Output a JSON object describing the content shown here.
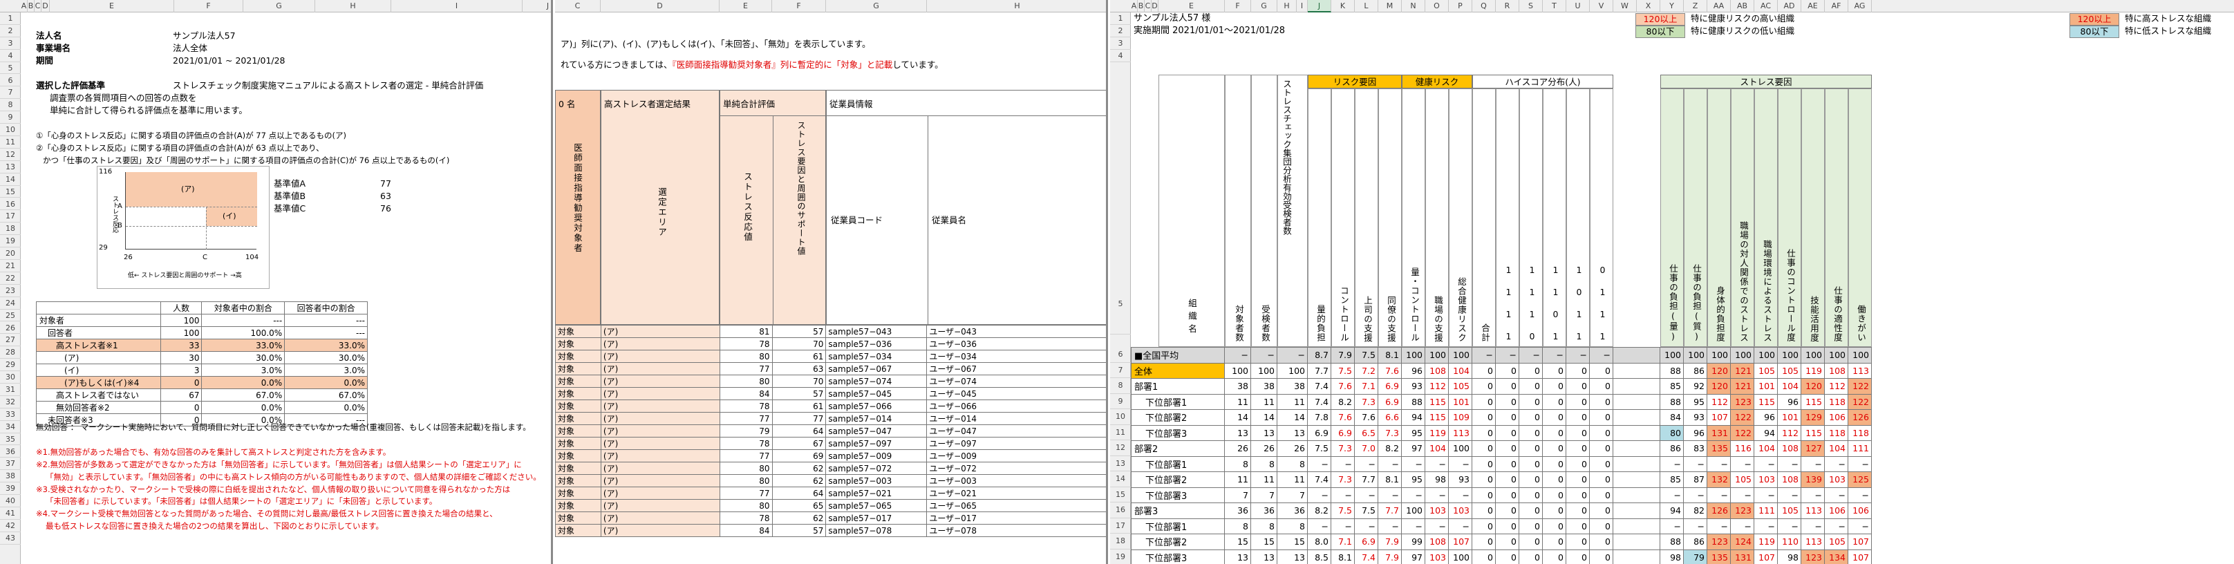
{
  "pane1": {
    "cols": [
      "A",
      "B",
      "C",
      "D",
      "E",
      "F",
      "G",
      "H",
      "I",
      "J"
    ],
    "info": [
      {
        "label": "法人名",
        "value": "サンプル法人57"
      },
      {
        "label": "事業場名",
        "value": "法人全体"
      },
      {
        "label": "期間",
        "value": "2021/01/01 ~ 2021/01/28"
      }
    ],
    "method_label": "選択した評価基準",
    "method_value": "ストレスチェック制度実施マニュアルによる高ストレス者の選定 - 単純合計評価",
    "method_lines": [
      "調査票の各質問項目への回答の点数を",
      "単純に合計して得られる評価点を基準に用います。"
    ],
    "criteria_lines": [
      "①「心身のストレス反応」に関する項目の評価点の合計(A)が 77 点以上であるもの(ア)",
      "②「心身のストレス反応」に関する項目の評価点の合計(A)が 63 点以上であり、",
      "かつ「仕事のストレス要因」及び「周囲のサポート」に関する項目の評価点の合計(C)が 76 点以上であるもの(イ)"
    ],
    "chart": {
      "y_top": "116",
      "y_bottom": "29",
      "x_left": "26",
      "x_right": "104",
      "marker_a": "A",
      "marker_b": "B",
      "marker_c": "C",
      "region_a": "(ア)",
      "region_i": "(イ)",
      "y_axis_label": "ストレス反応",
      "x_axis_label": "低← ストレス要因と周囲のサポート →高"
    },
    "thresholds": [
      {
        "label": "基準値A",
        "value": "77"
      },
      {
        "label": "基準値B",
        "value": "63"
      },
      {
        "label": "基準値C",
        "value": "76"
      }
    ],
    "summary_headers": [
      "",
      "人数",
      "対象者中の割合",
      "回答者中の割合"
    ],
    "summary_rows": [
      [
        "対象者",
        "100",
        "---",
        "---"
      ],
      [
        "回答者",
        "100",
        "100.0%",
        "---"
      ],
      [
        "高ストレス者※1",
        "33",
        "33.0%",
        "33.0%"
      ],
      [
        "(ア)",
        "30",
        "30.0%",
        "30.0%"
      ],
      [
        "(イ)",
        "3",
        "3.0%",
        "3.0%"
      ],
      [
        "(ア)もしくは(イ)※4",
        "0",
        "0.0%",
        "0.0%"
      ],
      [
        "高ストレス者ではない",
        "67",
        "67.0%",
        "67.0%"
      ],
      [
        "無効回答者※2",
        "0",
        "0.0%",
        "0.0%"
      ],
      [
        "未回答者※3",
        "0",
        "0.0%",
        "---"
      ]
    ],
    "notes": [
      "無効回答 ： マークシート実施時において、質問項目に対し正しく回答できていなかった場合(重複回答、もしくは回答未記載)を指します。",
      "",
      "※1.無効回答があった場合でも、有効な回答のみを集計して高ストレスと判定された方を含みます。",
      "※2.無効回答が多数あって選定ができなかった方は「無効回答者」に示しています。「無効回答者」は個人結果シートの「選定エリア」に",
      "「無効」と表示しています。「無効回答者」の中にも高ストレス傾向の方がいる可能性もありますので、個人結果の詳細をご確認ください。",
      "※3.受検されなかったり、マークシートで受検の際に白紙を提出されたなど、個人情報の取り扱いについて同意を得られなかった方は",
      "「未回答者」に示しています。「未回答者」は個人結果シートの「選定エリア」に「未回答」と示しています。",
      "※4.マークシート受検で無効回答となった質問があった場合、その質問に対し最高/最低ストレス回答に置き換えた場合の結果と、",
      "最も低ストレスな回答に置き換えた場合の2つの結果を算出し、下図のとおりに示しています。"
    ]
  },
  "pane2": {
    "cols": [
      "C",
      "D",
      "E",
      "F",
      "G",
      "H",
      "I"
    ],
    "line1": "ア)」列に(ア)、(イ)、(ア)もしくは(イ)、「未回答」、「無効」を表示しています。",
    "line2a": "れている方につきましては、",
    "line2b": "『医師面接指導勧奨対象者』列に暫定的に「対象」と記載",
    "line2c": "しています。",
    "headers": {
      "no": "0 名",
      "doctor": "医師面接指導勧奨対象者",
      "area_group": "高ストレス者選定結果",
      "area": "選定エリア",
      "sum_group": "単純合計評価",
      "stress": "ストレス反応値",
      "support": "ストレス要因と周囲のサポート値",
      "emp_group": "従業員情報",
      "code": "従業員コード",
      "name": "従業員名"
    },
    "rows": [
      [
        "対象",
        "(ア)",
        "81",
        "57",
        "sample57−043",
        "ユーザ−043"
      ],
      [
        "対象",
        "(ア)",
        "78",
        "70",
        "sample57−036",
        "ユーザ−036"
      ],
      [
        "対象",
        "(ア)",
        "80",
        "61",
        "sample57−034",
        "ユーザ−034"
      ],
      [
        "対象",
        "(ア)",
        "77",
        "63",
        "sample57−067",
        "ユーザ−067"
      ],
      [
        "対象",
        "(ア)",
        "80",
        "70",
        "sample57−074",
        "ユーザ−074"
      ],
      [
        "対象",
        "(ア)",
        "84",
        "57",
        "sample57−045",
        "ユーザ−045"
      ],
      [
        "対象",
        "(ア)",
        "78",
        "61",
        "sample57−066",
        "ユーザ−066"
      ],
      [
        "対象",
        "(ア)",
        "77",
        "77",
        "sample57−014",
        "ユーザ−014"
      ],
      [
        "対象",
        "(ア)",
        "79",
        "64",
        "sample57−047",
        "ユーザ−047"
      ],
      [
        "対象",
        "(ア)",
        "78",
        "67",
        "sample57−097",
        "ユーザ−097"
      ],
      [
        "対象",
        "(ア)",
        "77",
        "69",
        "sample57−009",
        "ユーザ−009"
      ],
      [
        "対象",
        "(ア)",
        "80",
        "62",
        "sample57−072",
        "ユーザ−072"
      ],
      [
        "対象",
        "(ア)",
        "80",
        "62",
        "sample57−003",
        "ユーザ−003"
      ],
      [
        "対象",
        "(ア)",
        "77",
        "64",
        "sample57−021",
        "ユーザ−021"
      ],
      [
        "対象",
        "(ア)",
        "80",
        "65",
        "sample57−065",
        "ユーザ−065"
      ],
      [
        "対象",
        "(ア)",
        "78",
        "62",
        "sample57−017",
        "ユーザ−017"
      ],
      [
        "対象",
        "(ア)",
        "84",
        "57",
        "sample57−078",
        "ユーザ−078"
      ]
    ]
  },
  "pane3": {
    "cols": [
      "A",
      "B",
      "C",
      "D",
      "E",
      "F",
      "G",
      "H",
      "I",
      "J",
      "K",
      "L",
      "M",
      "N",
      "O",
      "P",
      "Q",
      "R",
      "S",
      "T",
      "U",
      "V",
      "W",
      "X",
      "Y",
      "Z",
      "AA",
      "AB",
      "AC",
      "AD",
      "AE",
      "AF",
      "AG"
    ],
    "title": "サンプル法人57 様",
    "period": "実施期間 2021/01/01～2021/01/28",
    "legend": [
      {
        "badge": "120以上",
        "text": "特に健康リスクの高い組織"
      },
      {
        "badge": "80以下",
        "text": "特に健康リスクの低い組織"
      },
      {
        "badge": "120以上",
        "text": "特に高ストレスな組織"
      },
      {
        "badge": "80以下",
        "text": "特に低ストレスな組織"
      }
    ],
    "groups": {
      "risk": "リスク要因",
      "health": "健康リスク",
      "hiscore": "ハイスコア分布(人)",
      "stress": "ストレス要因"
    },
    "headers": {
      "org": "組織名",
      "targets": "対象者数",
      "examinees": "受検者数",
      "valid": "ストレスチェック集団分析有効受検者数",
      "risk": [
        "量的負担",
        "コントロール",
        "上司の支援",
        "同僚の支援"
      ],
      "health": [
        "量・コントロール",
        "職場の支援",
        "総合健康リスク"
      ],
      "hiscore": [
        "合計",
        "1 1 1 1",
        "1 1 1 0",
        "1 1 0 1",
        "1 0 1 1",
        "0 1 1 1"
      ],
      "stress": [
        "仕事の負担(量)",
        "仕事の負担(質)",
        "身体的負担度",
        "職場の対人関係でのストレス",
        "職場環境によるストレス",
        "仕事のコントロール度",
        "技能活用度",
        "仕事の適性度",
        "働きがい"
      ]
    },
    "rows": [
      {
        "n": "6",
        "org": "■全国平均",
        "ind": 0,
        "f": "",
        "v": [
          "−",
          "−",
          "−",
          "8.7",
          "7.9",
          "7.5",
          "8.1",
          "100",
          "100",
          "100",
          "−",
          "−",
          "−",
          "−",
          "−",
          "−",
          "100",
          "100",
          "100",
          "100",
          "100",
          "100",
          "100",
          "100",
          "100"
        ]
      },
      {
        "n": "7",
        "org": "全体",
        "ind": 0,
        "f": "yellow",
        "v": [
          "100",
          "100",
          "100",
          "7.7",
          "7.5",
          "7.2",
          "7.6",
          "96",
          "108",
          "104",
          "0",
          "0",
          "0",
          "0",
          "0",
          "0",
          "88",
          "86",
          "120",
          "121",
          "105",
          "105",
          "119",
          "108",
          "113"
        ]
      },
      {
        "n": "8",
        "org": "部署1",
        "ind": 0,
        "f": "",
        "v": [
          "38",
          "38",
          "38",
          "7.4",
          "7.6",
          "7.1",
          "6.9",
          "93",
          "112",
          "105",
          "0",
          "0",
          "0",
          "0",
          "0",
          "0",
          "85",
          "92",
          "120",
          "121",
          "101",
          "104",
          "120",
          "112",
          "122"
        ]
      },
      {
        "n": "9",
        "org": "下位部署1",
        "ind": 1,
        "f": "",
        "v": [
          "11",
          "11",
          "11",
          "7.4",
          "8.2",
          "7.3",
          "6.9",
          "88",
          "115",
          "101",
          "0",
          "0",
          "0",
          "0",
          "0",
          "0",
          "88",
          "95",
          "112",
          "123",
          "115",
          "96",
          "115",
          "118",
          "122"
        ]
      },
      {
        "n": "10",
        "org": "下位部署2",
        "ind": 1,
        "f": "",
        "v": [
          "14",
          "14",
          "14",
          "7.8",
          "7.6",
          "7.6",
          "6.6",
          "94",
          "115",
          "109",
          "0",
          "0",
          "0",
          "0",
          "0",
          "0",
          "84",
          "93",
          "107",
          "122",
          "96",
          "101",
          "129",
          "106",
          "126"
        ]
      },
      {
        "n": "11",
        "org": "下位部署3",
        "ind": 1,
        "f": "",
        "v": [
          "13",
          "13",
          "13",
          "6.9",
          "6.9",
          "6.5",
          "7.3",
          "95",
          "119",
          "113",
          "0",
          "0",
          "0",
          "0",
          "0",
          "0",
          "80",
          "96",
          "131",
          "122",
          "94",
          "112",
          "115",
          "118",
          "118"
        ]
      },
      {
        "n": "12",
        "org": "部署2",
        "ind": 0,
        "f": "",
        "v": [
          "26",
          "26",
          "26",
          "7.5",
          "7.3",
          "7.0",
          "8.2",
          "97",
          "104",
          "100",
          "0",
          "0",
          "0",
          "0",
          "0",
          "0",
          "86",
          "83",
          "135",
          "116",
          "104",
          "108",
          "127",
          "104",
          "111"
        ]
      },
      {
        "n": "13",
        "org": "下位部署1",
        "ind": 1,
        "f": "",
        "v": [
          "8",
          "8",
          "8",
          "−",
          "−",
          "−",
          "−",
          "−",
          "−",
          "−",
          "0",
          "0",
          "0",
          "0",
          "0",
          "0",
          "−",
          "−",
          "−",
          "−",
          "−",
          "−",
          "−",
          "−",
          "−"
        ]
      },
      {
        "n": "14",
        "org": "下位部署2",
        "ind": 1,
        "f": "",
        "v": [
          "11",
          "11",
          "11",
          "7.4",
          "7.3",
          "7.7",
          "8.1",
          "95",
          "98",
          "93",
          "0",
          "0",
          "0",
          "0",
          "0",
          "0",
          "85",
          "87",
          "132",
          "105",
          "103",
          "108",
          "139",
          "103",
          "125"
        ]
      },
      {
        "n": "15",
        "org": "下位部署3",
        "ind": 1,
        "f": "",
        "v": [
          "7",
          "7",
          "7",
          "−",
          "−",
          "−",
          "−",
          "−",
          "−",
          "−",
          "0",
          "0",
          "0",
          "0",
          "0",
          "0",
          "−",
          "−",
          "−",
          "−",
          "−",
          "−",
          "−",
          "−",
          "−"
        ]
      },
      {
        "n": "16",
        "org": "部署3",
        "ind": 0,
        "f": "",
        "v": [
          "36",
          "36",
          "36",
          "8.2",
          "7.5",
          "7.5",
          "7.7",
          "100",
          "103",
          "103",
          "0",
          "0",
          "0",
          "0",
          "0",
          "0",
          "94",
          "82",
          "126",
          "123",
          "111",
          "105",
          "113",
          "106",
          "106"
        ]
      },
      {
        "n": "17",
        "org": "下位部署1",
        "ind": 1,
        "f": "",
        "v": [
          "8",
          "8",
          "8",
          "−",
          "−",
          "−",
          "−",
          "−",
          "−",
          "−",
          "0",
          "0",
          "0",
          "0",
          "0",
          "0",
          "−",
          "−",
          "−",
          "−",
          "−",
          "−",
          "−",
          "−",
          "−"
        ]
      },
      {
        "n": "18",
        "org": "下位部署2",
        "ind": 1,
        "f": "",
        "v": [
          "15",
          "15",
          "15",
          "8.0",
          "7.1",
          "6.9",
          "7.9",
          "99",
          "108",
          "107",
          "0",
          "0",
          "0",
          "0",
          "0",
          "0",
          "88",
          "86",
          "123",
          "124",
          "119",
          "110",
          "113",
          "105",
          "107"
        ]
      },
      {
        "n": "19",
        "org": "下位部署3",
        "ind": 1,
        "f": "",
        "v": [
          "13",
          "13",
          "13",
          "8.5",
          "8.1",
          "7.4",
          "7.9",
          "97",
          "103",
          "100",
          "0",
          "0",
          "0",
          "0",
          "0",
          "0",
          "98",
          "79",
          "135",
          "131",
          "107",
          "98",
          "123",
          "134",
          "107"
        ]
      }
    ]
  }
}
